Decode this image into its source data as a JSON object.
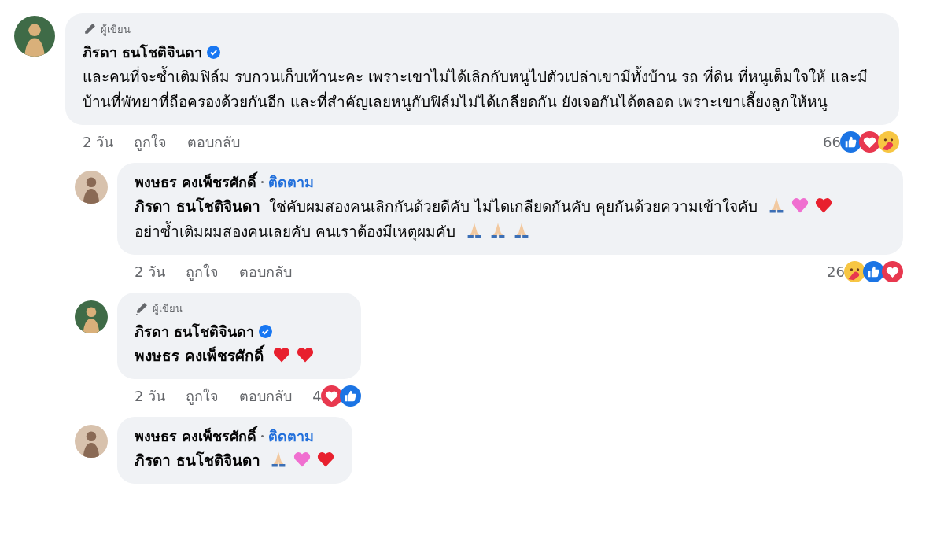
{
  "comments": [
    {
      "author": "ภิรดา ธนโชติจินดา",
      "author_label": "ผู้เขียน",
      "verified": true,
      "reply": false,
      "body": [
        {
          "kind": "text",
          "text": "และคนที่จะซ้ำเติมฟิล์ม รบกวนเก็บเท้านะคะ เพราะเขาไม่ได้เลิกกับหนูไปตัวเปล่าเขามีทั้งบ้าน รถ ที่ดิน ที่หนูเต็มใจให้ และมีบ้านที่พัทยาที่ถือครองด้วยกันอีก และที่สำคัญเลยหนูกับฟิล์มไม่ได้เกลียดกัน ยังเจอกันได้ตลอด เพราะเขาเลี้ยงลูกให้หนู"
        }
      ],
      "time": "2 วัน",
      "like": "ถูกใจ",
      "reply_label": "ตอบกลับ",
      "reaction_count": "66",
      "reactions": [
        {
          "kind": "like"
        },
        {
          "kind": "love"
        },
        {
          "kind": "care"
        }
      ]
    },
    {
      "author": "พงษธร คงเพ็ชรศักดิ์",
      "follow": "ติดตาม",
      "reply": true,
      "body": [
        {
          "kind": "mention",
          "text": "ภิรดา ธนโชติจินดา"
        },
        {
          "kind": "text",
          "text": "ใช่คับผมสองคนเลิกกันด้วยดีคับ ไม่ไดเกลียดกันคับ คุยกันด้วยความเข้าใจคับ"
        },
        {
          "kind": "pray"
        },
        {
          "kind": "pink-heart"
        },
        {
          "kind": "red-heart"
        },
        {
          "kind": "text",
          "text": "อย่าซ้ำเติมผมสองคนเลยคับ คนเราต้องมีเหตุผมคับ"
        },
        {
          "kind": "pray"
        },
        {
          "kind": "pray"
        },
        {
          "kind": "pray"
        }
      ],
      "time": "2 วัน",
      "like": "ถูกใจ",
      "reply_label": "ตอบกลับ",
      "reaction_count": "26",
      "reactions": [
        {
          "kind": "care"
        },
        {
          "kind": "like"
        },
        {
          "kind": "love"
        }
      ]
    },
    {
      "author": "ภิรดา ธนโชติจินดา",
      "author_label": "ผู้เขียน",
      "verified": true,
      "reply": true,
      "body": [
        {
          "kind": "mention",
          "text": "พงษธร คงเพ็ชรศักดิ์"
        },
        {
          "kind": "red-heart"
        },
        {
          "kind": "red-heart"
        }
      ],
      "time": "2 วัน",
      "like": "ถูกใจ",
      "reply_label": "ตอบกลับ",
      "reaction_count": "4",
      "reactions": [
        {
          "kind": "love"
        },
        {
          "kind": "like"
        }
      ]
    },
    {
      "author": "พงษธร คงเพ็ชรศักดิ์",
      "follow": "ติดตาม",
      "reply": true,
      "body": [
        {
          "kind": "mention",
          "text": "ภิรดา ธนโชติจินดา"
        },
        {
          "kind": "pray"
        },
        {
          "kind": "pink-heart"
        },
        {
          "kind": "red-heart"
        }
      ]
    }
  ]
}
